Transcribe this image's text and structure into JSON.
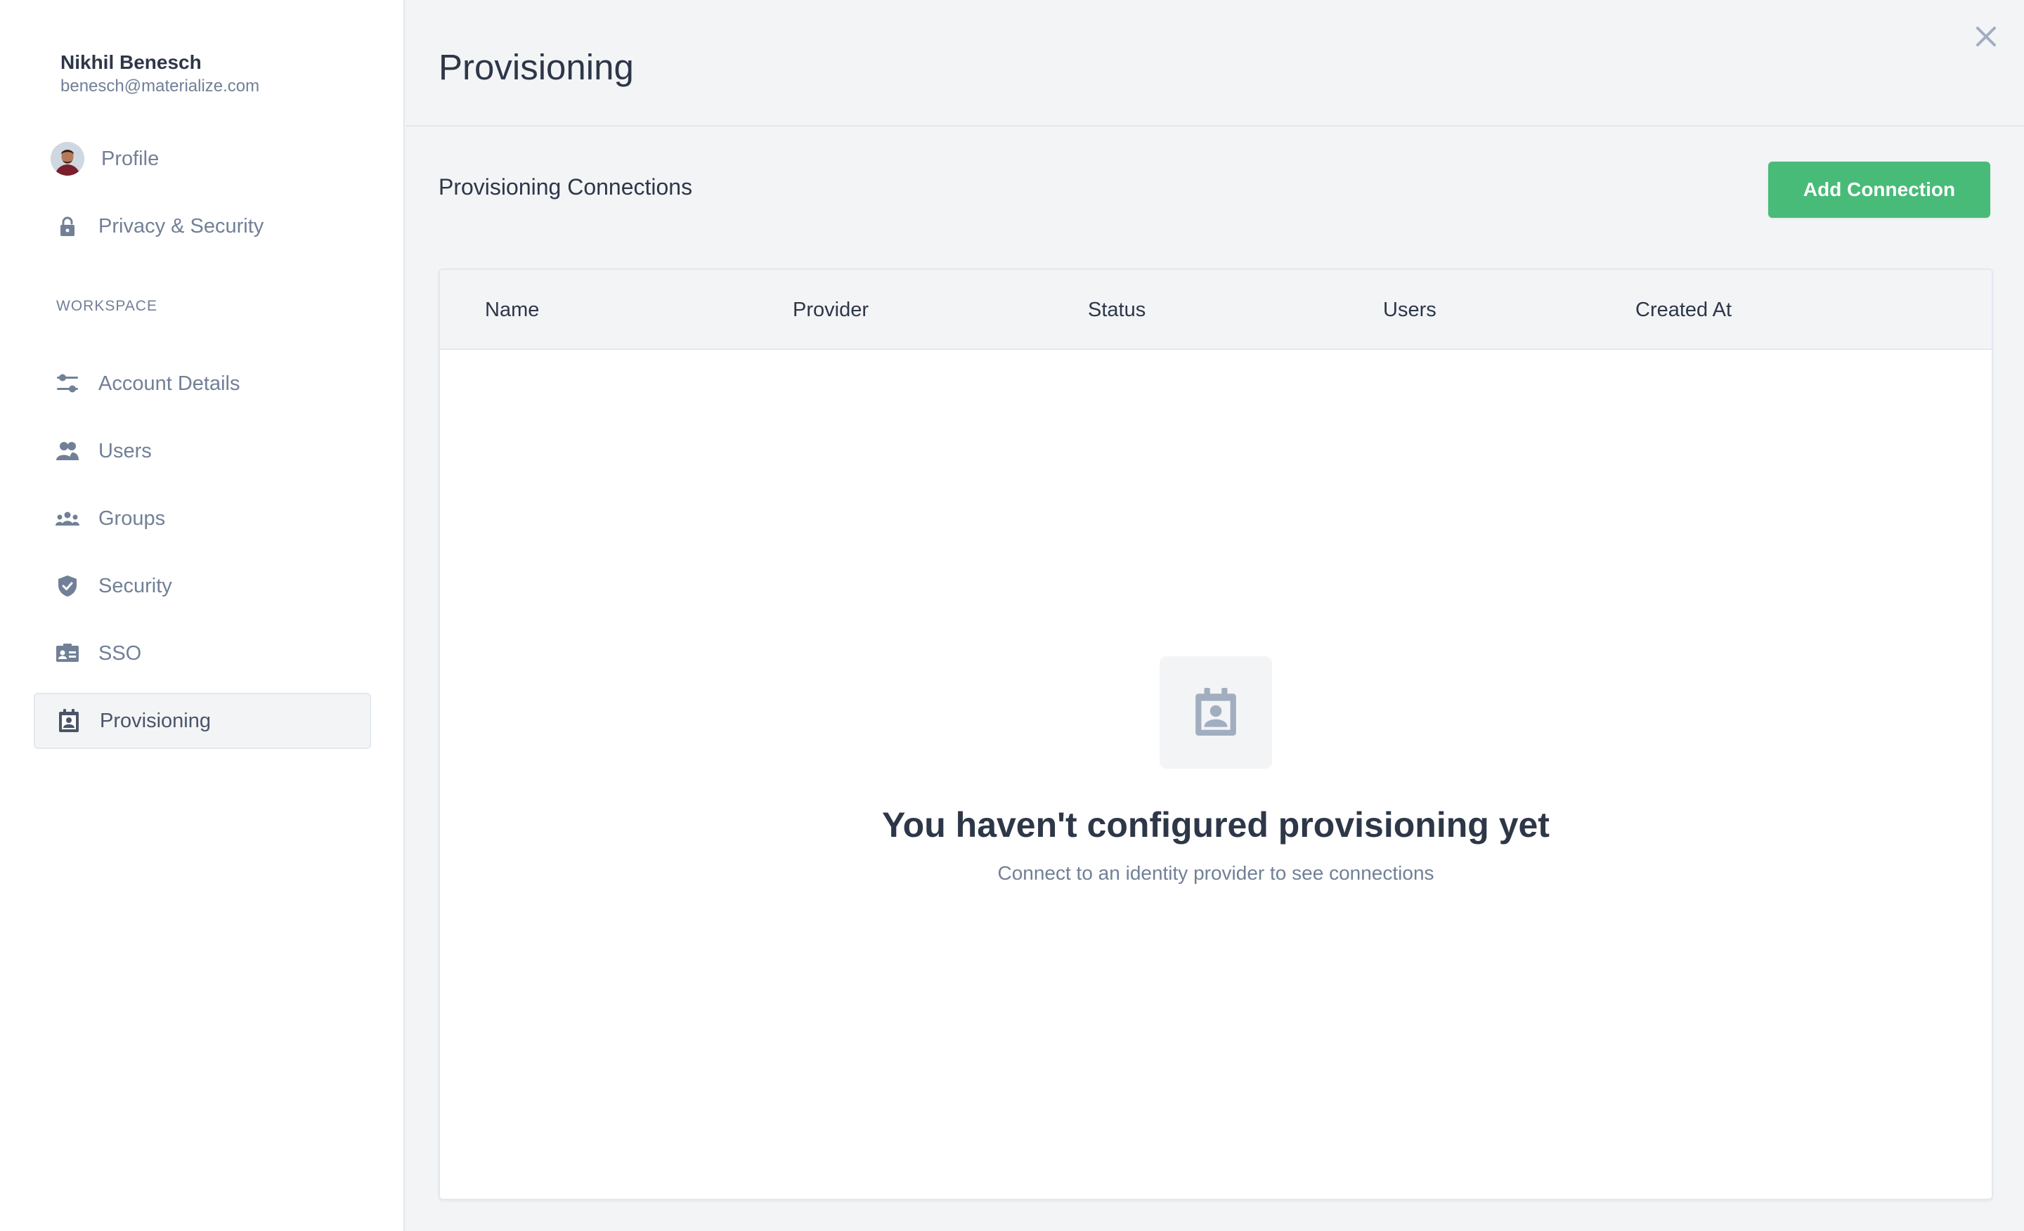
{
  "user": {
    "name": "Nikhil Benesch",
    "email": "benesch@materialize.com"
  },
  "sidebar": {
    "personal_items": [
      {
        "label": "Profile",
        "icon": "avatar"
      },
      {
        "label": "Privacy & Security",
        "icon": "lock-icon"
      }
    ],
    "section_label": "WORKSPACE",
    "workspace_items": [
      {
        "label": "Account Details",
        "icon": "sliders-icon"
      },
      {
        "label": "Users",
        "icon": "users-icon"
      },
      {
        "label": "Groups",
        "icon": "groups-icon"
      },
      {
        "label": "Security",
        "icon": "shield-icon"
      },
      {
        "label": "SSO",
        "icon": "id-card-icon"
      },
      {
        "label": "Provisioning",
        "icon": "badge-icon",
        "active": true
      }
    ]
  },
  "main": {
    "title": "Provisioning",
    "connections_heading": "Provisioning Connections",
    "add_button": "Add Connection",
    "table": {
      "columns": [
        "Name",
        "Provider",
        "Status",
        "Users",
        "Created At"
      ]
    },
    "empty_state": {
      "title": "You haven't configured provisioning yet",
      "subtitle": "Connect to an identity provider to see connections"
    }
  },
  "colors": {
    "accent_green": "#48bb78",
    "icon_gray": "#718096",
    "text_dark": "#2d3748",
    "background": "#f3f4f6"
  }
}
